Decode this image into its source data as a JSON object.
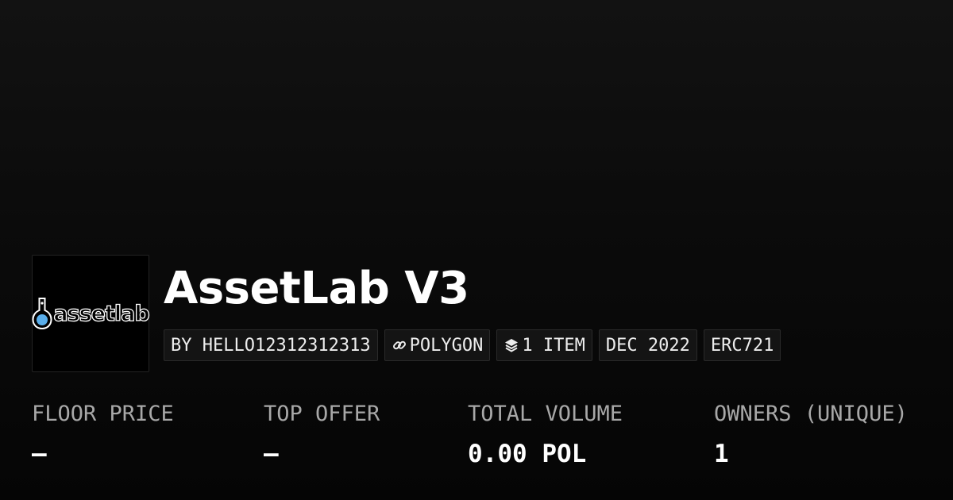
{
  "collection": {
    "logo_text": "assetlab",
    "title": "AssetLab V3"
  },
  "badges": {
    "creator": "BY HELLO12312312313",
    "chain": "POLYGON",
    "chain_icon": "link-icon",
    "items": "1 ITEM",
    "items_icon": "layers-icon",
    "date": "DEC 2022",
    "standard": "ERC721"
  },
  "stats": [
    {
      "label": "FLOOR PRICE",
      "value": "–"
    },
    {
      "label": "TOP OFFER",
      "value": "–"
    },
    {
      "label": "TOTAL VOLUME",
      "value": "0.00 POL"
    },
    {
      "label": "OWNERS (UNIQUE)",
      "value": "1"
    }
  ],
  "colors": {
    "background_top": "#121212",
    "background_bottom": "#050505",
    "logo_accent": "#5aaeea",
    "label_gray": "#a8a8a8"
  }
}
